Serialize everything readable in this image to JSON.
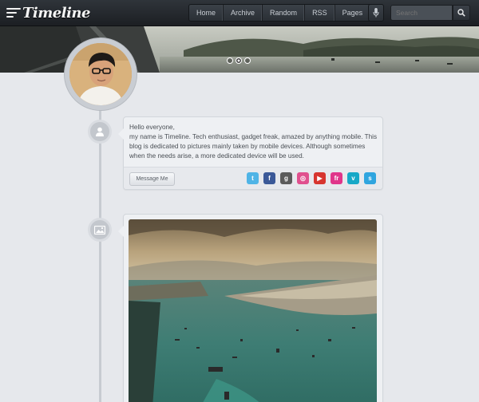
{
  "header": {
    "logo_text": "Timeline",
    "nav": [
      "Home",
      "Archive",
      "Random",
      "RSS",
      "Pages"
    ],
    "search_placeholder": "Search"
  },
  "banner": {
    "slide_count": 3,
    "active_slide": 2
  },
  "intro_post": {
    "lines": [
      "Hello everyone,",
      "my name is Timeline. Tech enthusiast, gadget freak, amazed by anything mobile. This blog is dedicated to pictures mainly taken by mobile devices. Although sometimes when the needs arise, a more dedicated device will be used."
    ],
    "message_button": "Message Me",
    "socials": [
      {
        "name": "twitter-icon",
        "glyph": "t",
        "color": "#4fb4e6"
      },
      {
        "name": "facebook-icon",
        "glyph": "f",
        "color": "#3b5998"
      },
      {
        "name": "google-plus-icon",
        "glyph": "g",
        "color": "#5b5b5b"
      },
      {
        "name": "dribbble-icon",
        "glyph": "◎",
        "color": "#e0508e"
      },
      {
        "name": "youtube-icon",
        "glyph": "▶",
        "color": "#d7352f"
      },
      {
        "name": "flickr-icon",
        "glyph": "fr",
        "color": "#e0358a"
      },
      {
        "name": "vimeo-icon",
        "glyph": "v",
        "color": "#17a8c7"
      },
      {
        "name": "skype-icon",
        "glyph": "s",
        "color": "#2fa5df"
      }
    ]
  },
  "icons": {
    "logo": "timeline-lines-icon",
    "mic": "microphone-icon",
    "search": "search-icon",
    "profile_node": "user-icon",
    "photo_node": "image-icon"
  }
}
